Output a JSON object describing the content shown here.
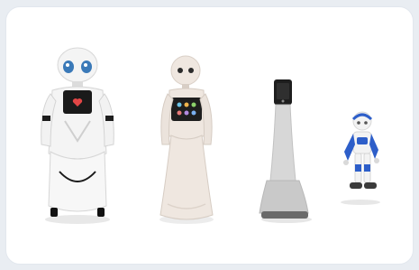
{
  "image": {
    "background_color": "#e9edf2",
    "panel_color": "#ffffff"
  },
  "robots": [
    {
      "name_icon": "white-companion-robot-icon",
      "colors": {
        "body": "#f4f4f4",
        "eyes": "#3a79b8",
        "chest_screen": "#1a1a1a",
        "heart": "#e24646",
        "accents": "#111111"
      }
    },
    {
      "name_icon": "humanoid-tablet-robot-icon",
      "colors": {
        "body": "#efe7e0",
        "eyes": "#2b2b2b",
        "tablet": "#1e1e1e"
      }
    },
    {
      "name_icon": "telepresence-kiosk-robot-icon",
      "colors": {
        "body": "#d7d7d7",
        "screen": "#1e1e1e",
        "base": "#6a6a6a"
      }
    },
    {
      "name_icon": "small-blue-humanoid-robot-icon",
      "colors": {
        "body": "#f3f3f3",
        "accents": "#2d5ec9"
      }
    }
  ]
}
